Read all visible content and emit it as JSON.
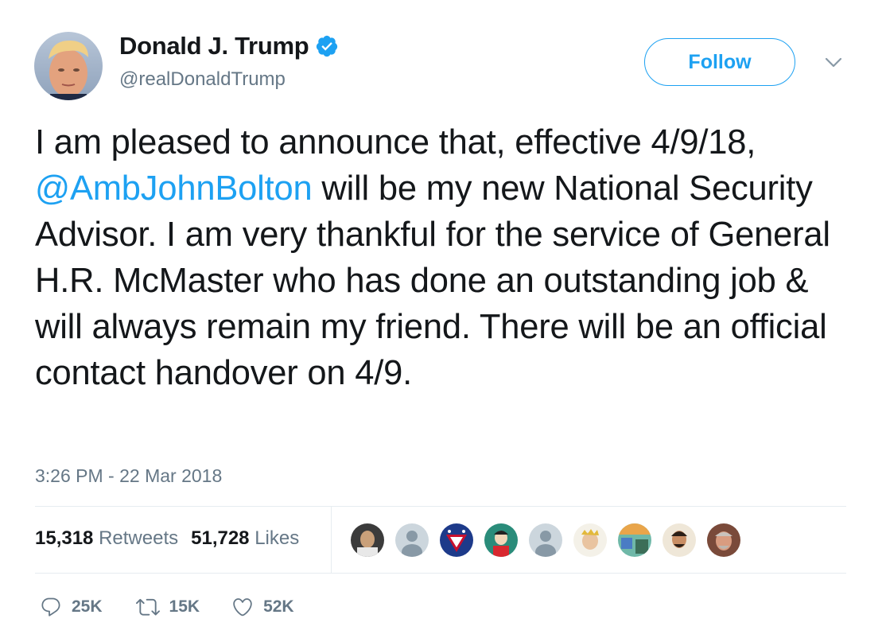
{
  "user": {
    "display_name": "Donald J. Trump",
    "handle": "@realDonaldTrump",
    "verified": true
  },
  "follow_button": {
    "label": "Follow"
  },
  "tweet": {
    "text_before_mention": "I am pleased to announce that, effective 4/9/18, ",
    "mention": "@AmbJohnBolton",
    "text_after_mention": " will be my new National Security Advisor. I am very thankful for the service of General H.R. McMaster who has done an outstanding job & will always remain my friend. There will be an official contact handover on 4/9.",
    "timestamp": "3:26 PM - 22 Mar 2018"
  },
  "stats": {
    "retweets_count": "15,318",
    "retweets_label": "Retweets",
    "likes_count": "51,728",
    "likes_label": "Likes"
  },
  "actions": {
    "reply_count": "25K",
    "retweet_count": "15K",
    "like_count": "52K"
  },
  "colors": {
    "accent": "#1da1f2",
    "muted": "#657786",
    "text": "#14171a",
    "divider": "#e6ecf0"
  }
}
